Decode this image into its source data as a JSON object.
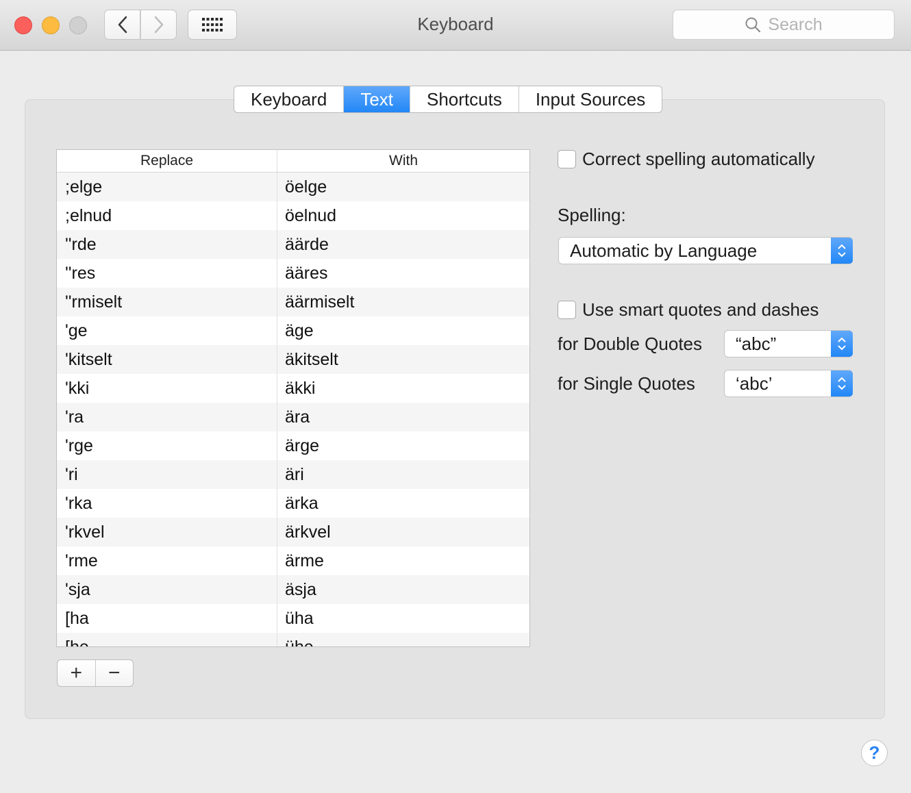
{
  "window": {
    "title": "Keyboard"
  },
  "toolbar": {
    "search_placeholder": "Search"
  },
  "tabs": [
    {
      "label": "Keyboard",
      "active": false
    },
    {
      "label": "Text",
      "active": true
    },
    {
      "label": "Shortcuts",
      "active": false
    },
    {
      "label": "Input Sources",
      "active": false
    }
  ],
  "table": {
    "headers": {
      "replace": "Replace",
      "with": "With"
    },
    "rows": [
      {
        "replace": ";elge",
        "with": "öelge"
      },
      {
        "replace": ";elnud",
        "with": "öelnud"
      },
      {
        "replace": "''rde",
        "with": "äärde"
      },
      {
        "replace": "''res",
        "with": "ääres"
      },
      {
        "replace": "''rmiselt",
        "with": "äärmiselt"
      },
      {
        "replace": "'ge",
        "with": "äge"
      },
      {
        "replace": "'kitselt",
        "with": "äkitselt"
      },
      {
        "replace": "'kki",
        "with": "äkki"
      },
      {
        "replace": "'ra",
        "with": "ära"
      },
      {
        "replace": "'rge",
        "with": "ärge"
      },
      {
        "replace": "'ri",
        "with": "äri"
      },
      {
        "replace": "'rka",
        "with": "ärka"
      },
      {
        "replace": "'rkvel",
        "with": "ärkvel"
      },
      {
        "replace": "'rme",
        "with": "ärme"
      },
      {
        "replace": "'sja",
        "with": "äsja"
      },
      {
        "replace": "[ha",
        "with": "üha"
      },
      {
        "replace": "[he",
        "with": "ühe"
      }
    ]
  },
  "buttons": {
    "add": "+",
    "remove": "−",
    "help": "?"
  },
  "settings": {
    "correct_spelling": {
      "label": "Correct spelling automatically",
      "checked": false
    },
    "spelling": {
      "label": "Spelling:",
      "value": "Automatic by Language"
    },
    "smart_quotes": {
      "label": "Use smart quotes and dashes",
      "checked": false
    },
    "double_quotes": {
      "label": "for Double Quotes",
      "value": "“abc”"
    },
    "single_quotes": {
      "label": "for Single Quotes",
      "value": "‘abc’"
    }
  },
  "colors": {
    "accent": "#2287f6",
    "close": "#fc605c",
    "minimize": "#fdbc40",
    "zoom": "#d0d0d0"
  }
}
